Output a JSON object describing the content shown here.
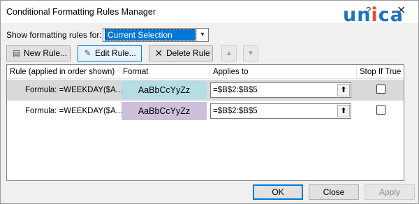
{
  "window": {
    "title": "Conditional Formatting Rules Manager",
    "help_glyph": "?",
    "close_glyph": "✕"
  },
  "watermark": {
    "text": "unica"
  },
  "filter": {
    "label": "Show formatting rules for:",
    "selected": "Current Selection"
  },
  "toolbar": {
    "new_rule": "New Rule...",
    "edit_rule": "Edit Rule...",
    "delete_rule": "Delete Rule",
    "move_up": "▲",
    "move_down": "▼"
  },
  "table": {
    "columns": [
      "Rule (applied in order shown)",
      "Format",
      "Applies to",
      "Stop If True"
    ],
    "rows": [
      {
        "rule": "Formula: =WEEKDAY($A...",
        "format_preview": "AaBbCcYyZz",
        "format_color": "#b4dde6",
        "applies_to": "=$B$2:$B$5",
        "stop_if_true": false,
        "selected": true
      },
      {
        "rule": "Formula: =WEEKDAY($A...",
        "format_preview": "AaBbCcYyZz",
        "format_color": "#ccc0da",
        "applies_to": "=$B$2:$B$5",
        "stop_if_true": false,
        "selected": false
      }
    ]
  },
  "buttons": {
    "ok": "OK",
    "close": "Close",
    "apply": "Apply"
  },
  "colors": {
    "accent": "#0078d7",
    "row_selected": "#d9d9d9"
  }
}
